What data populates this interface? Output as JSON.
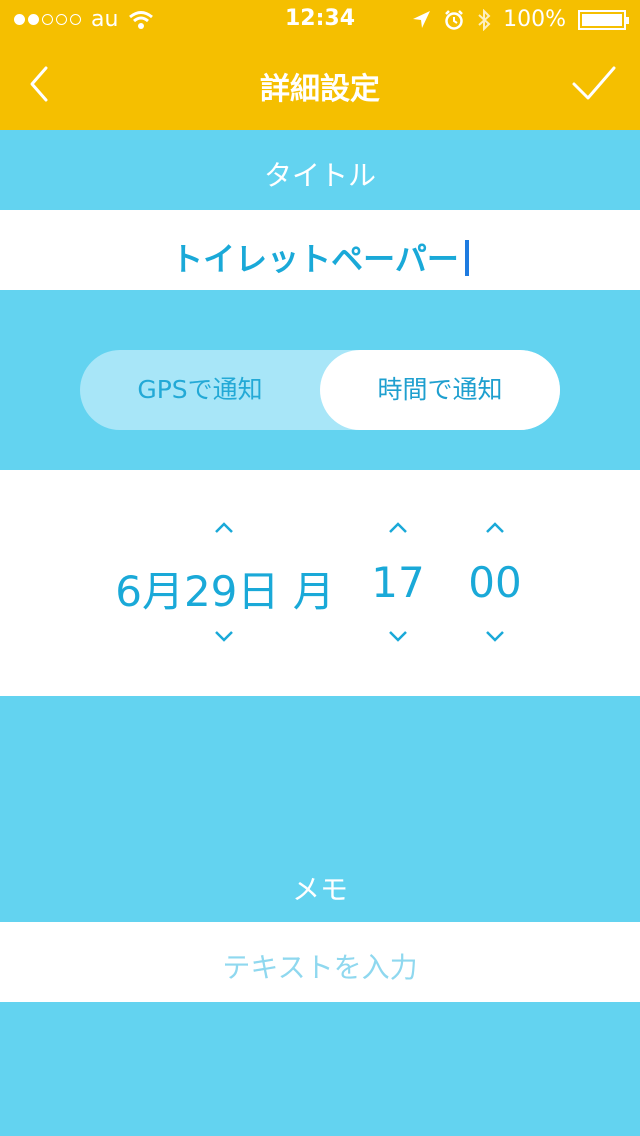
{
  "status_bar": {
    "carrier": "au",
    "time": "12:34",
    "battery": "100%"
  },
  "nav": {
    "title": "詳細設定"
  },
  "title_section": {
    "label": "タイトル",
    "value": "トイレットペーパー"
  },
  "notify_toggle": {
    "options": [
      "GPSで通知",
      "時間で通知"
    ],
    "selected": "時間で通知"
  },
  "picker": {
    "date": "6月29日 月",
    "hour": "17",
    "minute": "00"
  },
  "memo": {
    "label": "メモ",
    "placeholder": "テキストを入力"
  },
  "colors": {
    "header": "#f5bf00",
    "background": "#63d3f0",
    "accent": "#1aa9d8"
  }
}
